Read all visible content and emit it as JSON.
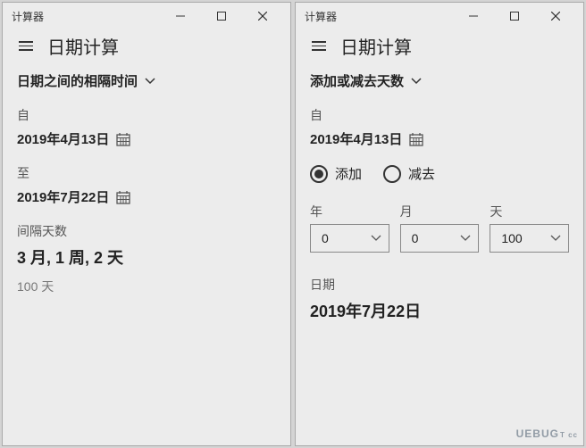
{
  "left": {
    "app_title": "计算器",
    "page_title": "日期计算",
    "mode_label": "日期之间的相隔时间",
    "from_label": "自",
    "from_date": "2019年4月13日",
    "to_label": "至",
    "to_date": "2019年7月22日",
    "result_label": "间隔天数",
    "result_main": "3 月, 1 周, 2 天",
    "result_sub": "100 天"
  },
  "right": {
    "app_title": "计算器",
    "page_title": "日期计算",
    "mode_label": "添加或减去天数",
    "from_label": "自",
    "from_date": "2019年4月13日",
    "radio_add": "添加",
    "radio_sub": "减去",
    "year_label": "年",
    "month_label": "月",
    "day_label": "天",
    "year_value": "0",
    "month_value": "0",
    "day_value": "100",
    "result_label": "日期",
    "result_date": "2019年7月22日"
  },
  "watermark": {
    "main": "UEBUG",
    "sub": "T cc"
  }
}
